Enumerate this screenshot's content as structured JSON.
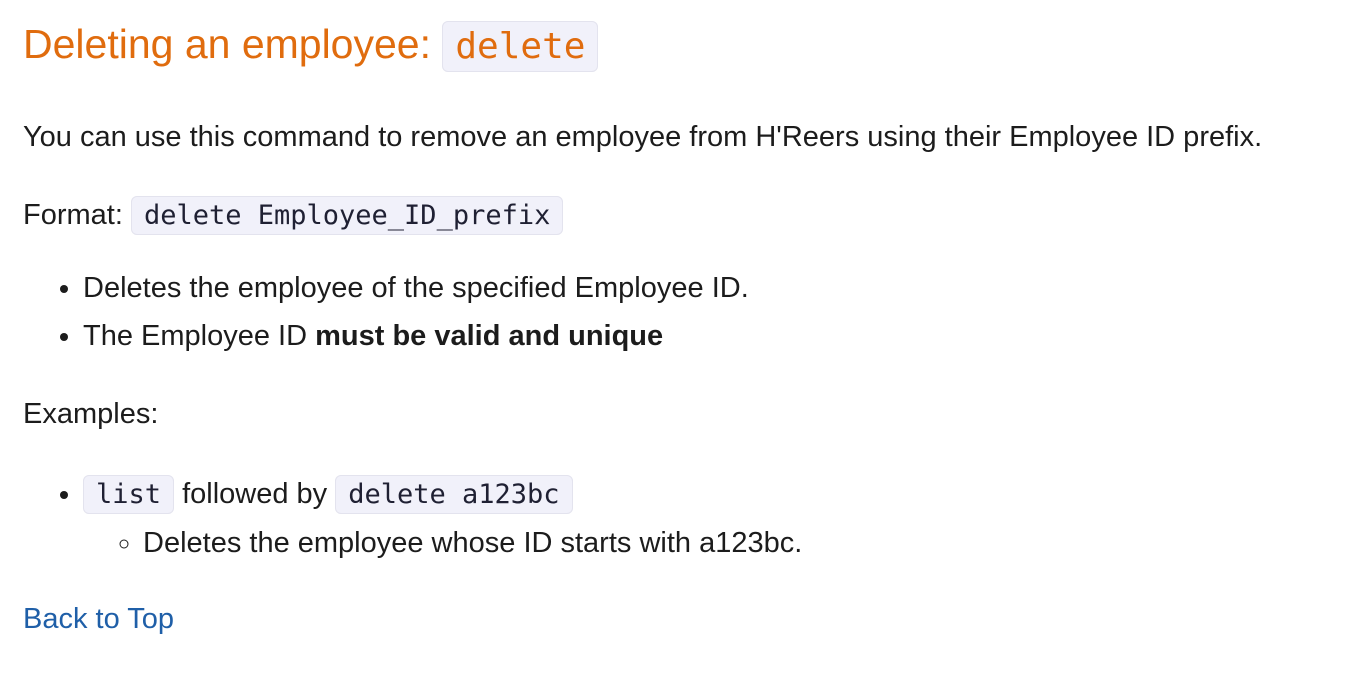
{
  "heading": {
    "text": "Deleting an employee: ",
    "code": "delete"
  },
  "intro": "You can use this command to remove an employee from H'Reers using their Employee ID prefix.",
  "format": {
    "label": "Format: ",
    "code": "delete Employee_ID_prefix"
  },
  "notes": {
    "item1": "Deletes the employee of the specified Employee ID.",
    "item2_prefix": "The Employee ID ",
    "item2_bold": "must be valid and unique"
  },
  "examples": {
    "label": "Examples:",
    "item1": {
      "code1": "list",
      "middle": " followed by ",
      "code2": "delete a123bc",
      "sub": "Deletes the employee whose ID starts with a123bc."
    }
  },
  "back_link": "Back to Top",
  "colors": {
    "heading": "#e06c0e",
    "link": "#1f5fa8",
    "code_bg": "#f1f1fa"
  }
}
